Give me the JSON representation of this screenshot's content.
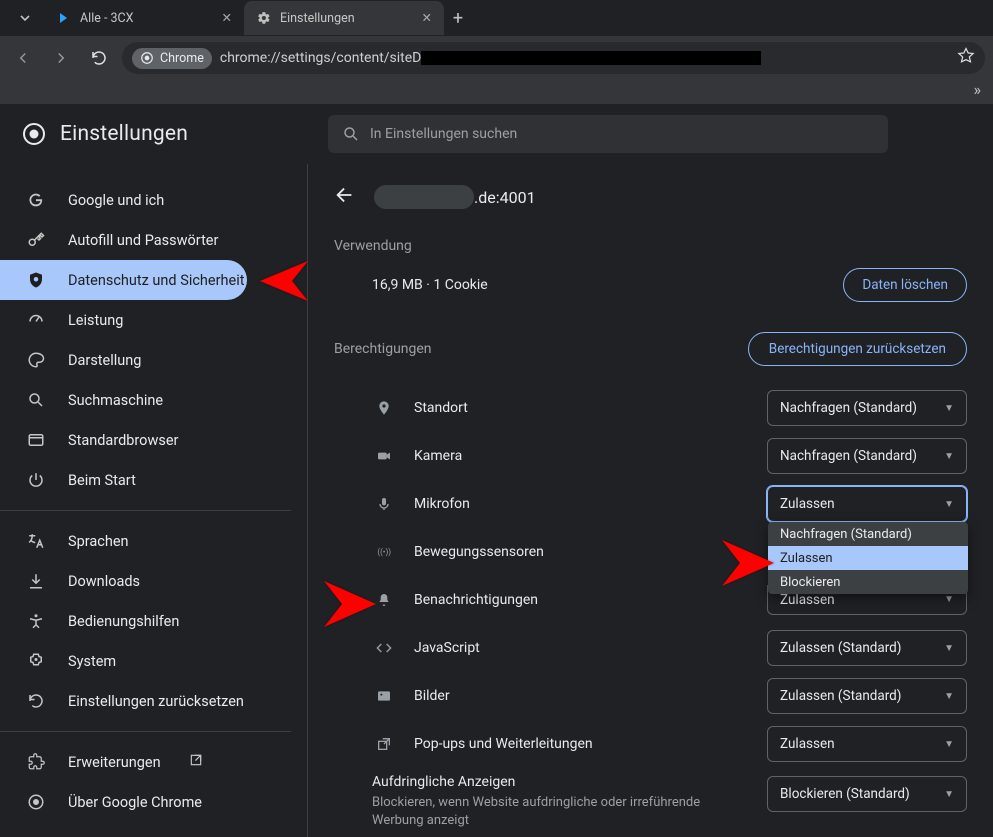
{
  "tabs": [
    {
      "label": "Alle - 3CX",
      "active": false
    },
    {
      "label": "Einstellungen",
      "active": true
    }
  ],
  "toolbar": {
    "chrome_pill": "Chrome",
    "url_prefix": "chrome://settings/content/siteD"
  },
  "brand": {
    "title": "Einstellungen"
  },
  "search": {
    "placeholder": "In Einstellungen suchen"
  },
  "sidebar": {
    "items": [
      {
        "label": "Google und ich",
        "icon": "google"
      },
      {
        "label": "Autofill und Passwörter",
        "icon": "key"
      },
      {
        "label": "Datenschutz und Sicherheit",
        "icon": "shield",
        "selected": true
      },
      {
        "label": "Leistung",
        "icon": "speed"
      },
      {
        "label": "Darstellung",
        "icon": "palette"
      },
      {
        "label": "Suchmaschine",
        "icon": "search"
      },
      {
        "label": "Standardbrowser",
        "icon": "browser"
      },
      {
        "label": "Beim Start",
        "icon": "power"
      }
    ],
    "items2": [
      {
        "label": "Sprachen",
        "icon": "translate"
      },
      {
        "label": "Downloads",
        "icon": "download"
      },
      {
        "label": "Bedienungshilfen",
        "icon": "accessibility"
      },
      {
        "label": "System",
        "icon": "system"
      },
      {
        "label": "Einstellungen zurücksetzen",
        "icon": "reset"
      }
    ],
    "items3": [
      {
        "label": "Erweiterungen",
        "icon": "extension",
        "external": true
      },
      {
        "label": "Über Google Chrome",
        "icon": "chrome"
      }
    ]
  },
  "site": {
    "host_suffix": ".de:4001"
  },
  "usage": {
    "section": "Verwendung",
    "text": "16,9 MB · 1 Cookie",
    "clear": "Daten löschen"
  },
  "perm": {
    "section": "Berechtigungen",
    "reset": "Berechtigungen zurücksetzen",
    "rows": [
      {
        "label": "Standort",
        "value": "Nachfragen (Standard)",
        "icon": "location"
      },
      {
        "label": "Kamera",
        "value": "Nachfragen (Standard)",
        "icon": "camera"
      },
      {
        "label": "Mikrofon",
        "value": "Zulassen",
        "icon": "mic",
        "open": true
      },
      {
        "label": "Bewegungssensoren",
        "value": "",
        "icon": "motion"
      },
      {
        "label": "Benachrichtigungen",
        "value": "Zulassen",
        "icon": "bell"
      },
      {
        "label": "JavaScript",
        "value": "Zulassen (Standard)",
        "icon": "code"
      },
      {
        "label": "Bilder",
        "value": "Zulassen (Standard)",
        "icon": "image"
      },
      {
        "label": "Pop-ups und Weiterleitungen",
        "value": "Zulassen",
        "icon": "popup"
      }
    ],
    "menu": {
      "options": [
        "Nachfragen (Standard)",
        "Zulassen",
        "Blockieren"
      ],
      "highlight": 1
    },
    "intrusive": {
      "title": "Aufdringliche Anzeigen",
      "desc": "Blockieren, wenn Website aufdringliche oder irreführende Werbung anzeigt",
      "value": "Blockieren (Standard)"
    }
  }
}
